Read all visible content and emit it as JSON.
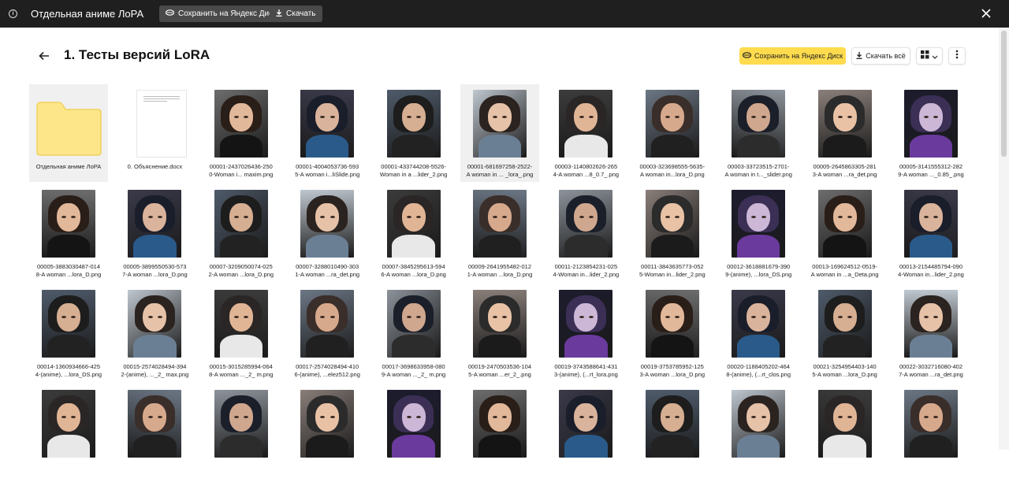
{
  "topbar": {
    "title": "Отдельная аниме ЛоРА",
    "save_label": "Сохранить на Яндекс Диск",
    "download_label": "Скачать"
  },
  "header": {
    "title": "1. Тесты версий LoRA",
    "save_label": "Сохранить на Яндекс Диск",
    "download_all_label": "Скачать всё"
  },
  "colors": {
    "accent_yellow": "#ffdb4d",
    "topbar_bg": "#1f1f1f",
    "folder_yellow": "#fde68a"
  },
  "items": [
    {
      "type": "folder",
      "name": "Отдельная аниме ЛоРА",
      "line1": "Отдельная аниме ЛоРА",
      "line2": ""
    },
    {
      "type": "doc",
      "name": "0. Объяснение.docx",
      "line1": "0. Объяснение.docx",
      "line2": ""
    },
    {
      "type": "image",
      "line1": "00001-2437026436-250",
      "line2": "0-Woman i... maxim.png"
    },
    {
      "type": "image",
      "line1": "00001-4004053736-593",
      "line2": "5-A woman i...liSlide.png"
    },
    {
      "type": "image",
      "line1": "00001-433744208-5526-",
      "line2": "Woman in a ...lider_2.png"
    },
    {
      "type": "image",
      "line1": "00001-681697258-2522-",
      "line2": "A woman in ... _lora_.png"
    },
    {
      "type": "image",
      "line1": "00003-1140802626-265",
      "line2": "4-A woman ...8_0.7_.png"
    },
    {
      "type": "image",
      "line1": "00003-323698555-5635-",
      "line2": "A woman in...lora_D.png"
    },
    {
      "type": "image",
      "line1": "00003-33723515-2701-",
      "line2": "A woman in t..._slider.png"
    },
    {
      "type": "image",
      "line1": "00005-2645863305-281",
      "line2": "3-A woman ...ra_det.png"
    },
    {
      "type": "image",
      "line1": "00005-3141555312-282",
      "line2": "9-A woman ..._0.85_.png"
    },
    {
      "type": "image",
      "line1": "00005-3883030487-014",
      "line2": "8-A woman ...lora_D.png"
    },
    {
      "type": "image",
      "line1": "00005-3899550530-573",
      "line2": "7-A woman ...lora_D.png"
    },
    {
      "type": "image",
      "line1": "00007-3209050074-025",
      "line2": "2-A woman ...lora_D.png"
    },
    {
      "type": "image",
      "line1": "00007-3288010490-303",
      "line2": "1-A woman ...ra_det.png"
    },
    {
      "type": "image",
      "line1": "00007-3845295613-594",
      "line2": "6-A woman ...lora_D.png"
    },
    {
      "type": "image",
      "line1": "00009-2641955482-012",
      "line2": "1-A woman ...lora_D.png"
    },
    {
      "type": "image",
      "line1": "00011-2123854231-025",
      "line2": "4-Woman in...lider_2.png"
    },
    {
      "type": "image",
      "line1": "00011-3843635773-052",
      "line2": "5-Woman in...lider_2.png"
    },
    {
      "type": "image",
      "line1": "00012-3618881679-390",
      "line2": "9-(anime), ...lora_DS.png"
    },
    {
      "type": "image",
      "line1": "00013-169624512-0519-",
      "line2": "A woman in ...a_Deta.png"
    },
    {
      "type": "image",
      "line1": "00013-2154485794-090",
      "line2": "4-Woman in...lider_2.png"
    },
    {
      "type": "image",
      "line1": "00014-1360934666-425",
      "line2": "4-(anime), ...lora_DS.png"
    },
    {
      "type": "image",
      "line1": "00015-2574028494-394",
      "line2": "2-(anime), ..._2_ max.png"
    },
    {
      "type": "image",
      "line1": "00015-3015285994-064",
      "line2": "8-A woman ..._2_ m.png"
    },
    {
      "type": "image",
      "line1": "00017-2574028494-410",
      "line2": "6-(anime), ...elez512.png"
    },
    {
      "type": "image",
      "line1": "00017-3698633958-080",
      "line2": "9-A woman ..._2_ m.png"
    },
    {
      "type": "image",
      "line1": "00019-2470503536-104",
      "line2": "5-A woman ...er_2_.png"
    },
    {
      "type": "image",
      "line1": "00019-3743588641-431",
      "line2": "3-(anime), (...rt_lora.png"
    },
    {
      "type": "image",
      "line1": "00019-3753785952-125",
      "line2": "3-A woman ...lora_D.png"
    },
    {
      "type": "image",
      "line1": "00020-1188405202-464",
      "line2": "8-(anime), (...rt_clos.png"
    },
    {
      "type": "image",
      "line1": "00021-3254954403-140",
      "line2": "5-A woman ...lora_D.png"
    },
    {
      "type": "image",
      "line1": "00022-3032716080-402",
      "line2": "7-A woman ...ra_det.png"
    },
    {
      "type": "image",
      "line1": "",
      "line2": ""
    },
    {
      "type": "image",
      "line1": "",
      "line2": ""
    },
    {
      "type": "image",
      "line1": "",
      "line2": ""
    },
    {
      "type": "image",
      "line1": "",
      "line2": ""
    },
    {
      "type": "image",
      "line1": "",
      "line2": ""
    },
    {
      "type": "image",
      "line1": "",
      "line2": ""
    },
    {
      "type": "image",
      "line1": "",
      "line2": ""
    },
    {
      "type": "image",
      "line1": "",
      "line2": ""
    },
    {
      "type": "image",
      "line1": "",
      "line2": ""
    },
    {
      "type": "image",
      "line1": "",
      "line2": ""
    },
    {
      "type": "image",
      "line1": "",
      "line2": ""
    }
  ]
}
